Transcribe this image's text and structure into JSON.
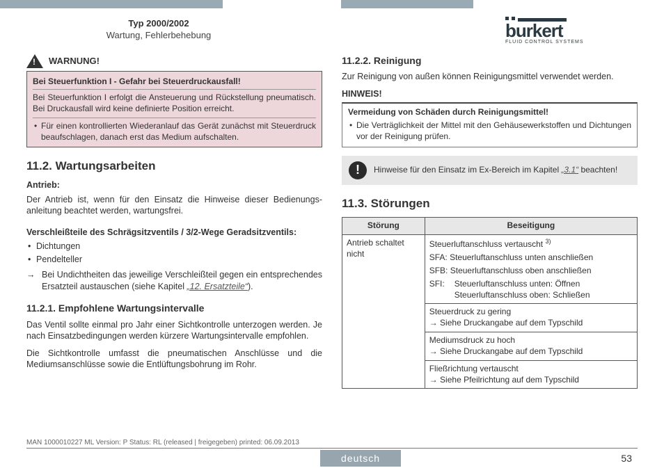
{
  "header": {
    "type_line": "Typ 2000/2002",
    "section": "Wartung, Fehlerbehebung",
    "brand": "burkert",
    "brand_sub": "FLUID CONTROL SYSTEMS"
  },
  "left": {
    "warn_label": "WARNUNG!",
    "warn_title": "Bei Steuerfunktion I - Gefahr bei Steuerdruckausfall!",
    "warn_body": "Bei Steuerfunktion I erfolgt die Ansteuerung und Rückstellung pneumatisch. Bei Druckausfall wird keine definierte Position erreicht.",
    "warn_bullet": "Für einen kontrollierten Wiederanlauf das Gerät zunächst mit Steuerdruck beaufschlagen, danach erst das Medium aufschalten.",
    "h11_2": "11.2.   Wartungsarbeiten",
    "antrieb_label": "Antrieb:",
    "antrieb_p": "Der Antrieb ist, wenn für den Einsatz die Hinweise dieser Bedienungs­anleitung beachtet werden, wartungsfrei.",
    "versch_label": "Verschleißteile des Schrägsitzventils / 3/2-Wege Geradsitzventils:",
    "b1": "Dichtungen",
    "b2": "Pendelteller",
    "arrow1a": "Bei Undichtheiten das jeweilige Verschleißteil gegen ein entspre­chendes Ersatzteil austauschen (siehe Kapitel ",
    "arrow1_link": "„12. Ersatzteile“",
    "arrow1b": ").",
    "h11_2_1": "11.2.1. Empfohlene Wartungsintervalle",
    "p1": "Das Ventil sollte einmal pro Jahr einer Sichtkontrolle unterzogen werden. Je nach Einsatzbedingungen werden kürzere Wartungsinter­valle empfohlen.",
    "p2": "Die Sichtkontrolle umfasst die pneumatischen Anschlüsse und die Mediumsanschlüsse sowie die Entlüftungsbohrung im Rohr."
  },
  "right": {
    "h11_2_2": "11.2.2. Reinigung",
    "p_rein": "Zur Reinigung von außen können Reinigungsmittel verwendet werden.",
    "hinweis_label": "HINWEIS!",
    "hin_title": "Vermeidung von Schäden durch Reinigungsmittel!",
    "hin_bullet": "Die Verträglichkeit der Mittel mit den Gehäusewerkstoffen und Dichtungen vor der Reinigung prüfen.",
    "info_a": "Hinweise für den Einsatz im Ex-Bereich im Kapitel ",
    "info_link": "„3.1“",
    "info_b": " beachten!",
    "h11_3": "11.3.   Störungen",
    "th1": "Störung",
    "th2": "Beseitigung",
    "r1c1": "Antrieb schaltet nicht",
    "r1_l1": "Steuerluftanschluss vertauscht ",
    "r1_sup": "3)",
    "r1_sfa": "SFA: Steuerluftanschluss unten anschließen",
    "r1_sfb": "SFB: Steuerluftanschluss oben anschließen",
    "r1_sfi_lab": "SFI:",
    "r1_sfi_a": "Steuerluftanschluss unten: Öffnen",
    "r1_sfi_b": "Steuerluftanschluss oben: Schließen",
    "r2a": "Steuerdruck zu gering",
    "r2b": "→ Siehe Druckangabe auf dem Typschild",
    "r3a": "Mediumsdruck zu hoch",
    "r3b": "→ Siehe Druckangabe auf dem Typschild",
    "r4a": "Fließrichtung vertauscht",
    "r4b": "→ Siehe Pfeilrichtung auf dem Typschild"
  },
  "footer": {
    "meta": "MAN  1000010227  ML  Version: P Status: RL (released | freigegeben)  printed: 06.09.2013",
    "lang": "deutsch",
    "page": "53"
  }
}
